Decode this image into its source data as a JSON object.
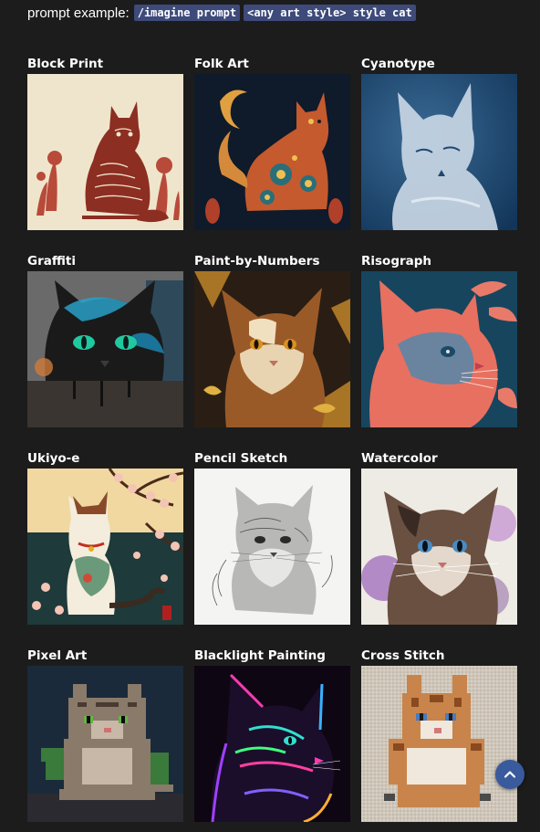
{
  "prompt": {
    "label": "prompt example:",
    "command": "/imagine prompt",
    "template": "<any art style> style cat"
  },
  "styles": [
    {
      "title": "Block Print"
    },
    {
      "title": "Folk Art"
    },
    {
      "title": "Cyanotype"
    },
    {
      "title": "Graffiti"
    },
    {
      "title": "Paint-by-Numbers"
    },
    {
      "title": "Risograph"
    },
    {
      "title": "Ukiyo-e"
    },
    {
      "title": "Pencil Sketch"
    },
    {
      "title": "Watercolor"
    },
    {
      "title": "Pixel Art"
    },
    {
      "title": "Blacklight Painting"
    },
    {
      "title": "Cross Stitch"
    }
  ],
  "scroll_top": {
    "icon": "chevron-up-icon"
  }
}
